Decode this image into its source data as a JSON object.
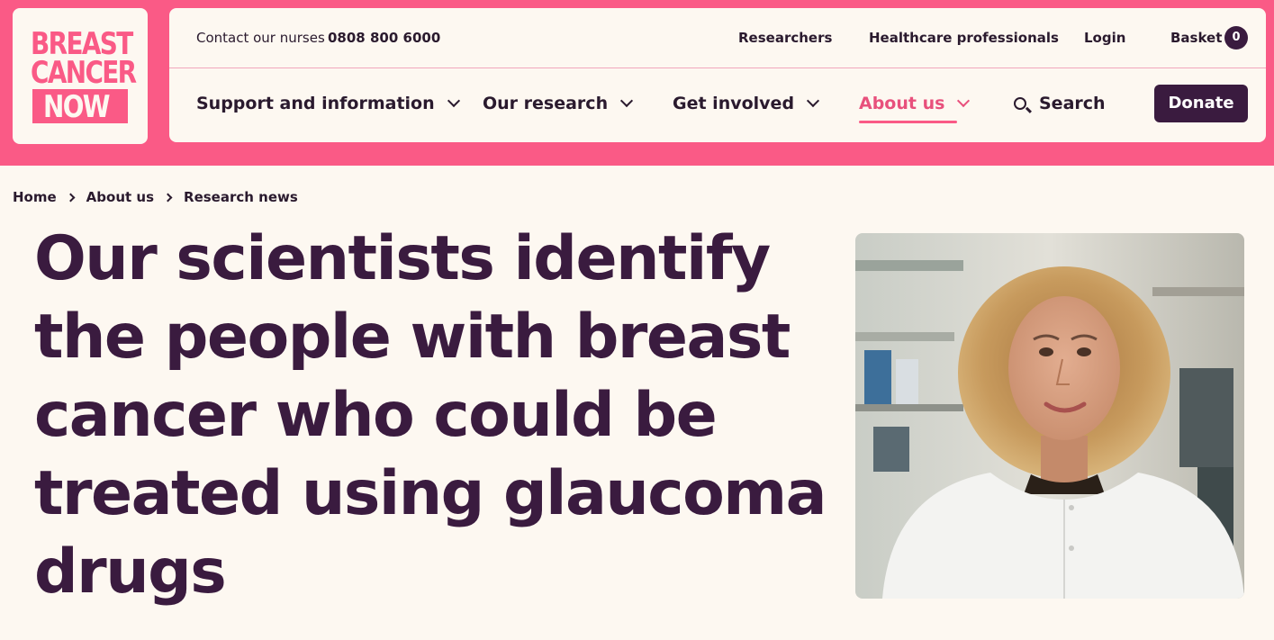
{
  "logo": {
    "line1": "BREAST",
    "line2": "CANCER",
    "line3": "NOW"
  },
  "topbar": {
    "contact_label": "Contact our nurses",
    "contact_phone": "0808 800 6000",
    "researchers": "Researchers",
    "healthcare": "Healthcare professionals",
    "login": "Login",
    "basket": "Basket",
    "basket_count": "0"
  },
  "nav": {
    "support": "Support and information",
    "research": "Our research",
    "involved": "Get involved",
    "about": "About us",
    "search": "Search",
    "donate": "Donate"
  },
  "breadcrumb": {
    "home": "Home",
    "about": "About us",
    "current": "Research news"
  },
  "article": {
    "headline": "Our scientists identify the people with breast cancer who could be treated using glaucoma drugs"
  },
  "colors": {
    "brand_pink": "#fa5a86",
    "brand_plum": "#3a1b3f",
    "background": "#fdf8f1"
  }
}
